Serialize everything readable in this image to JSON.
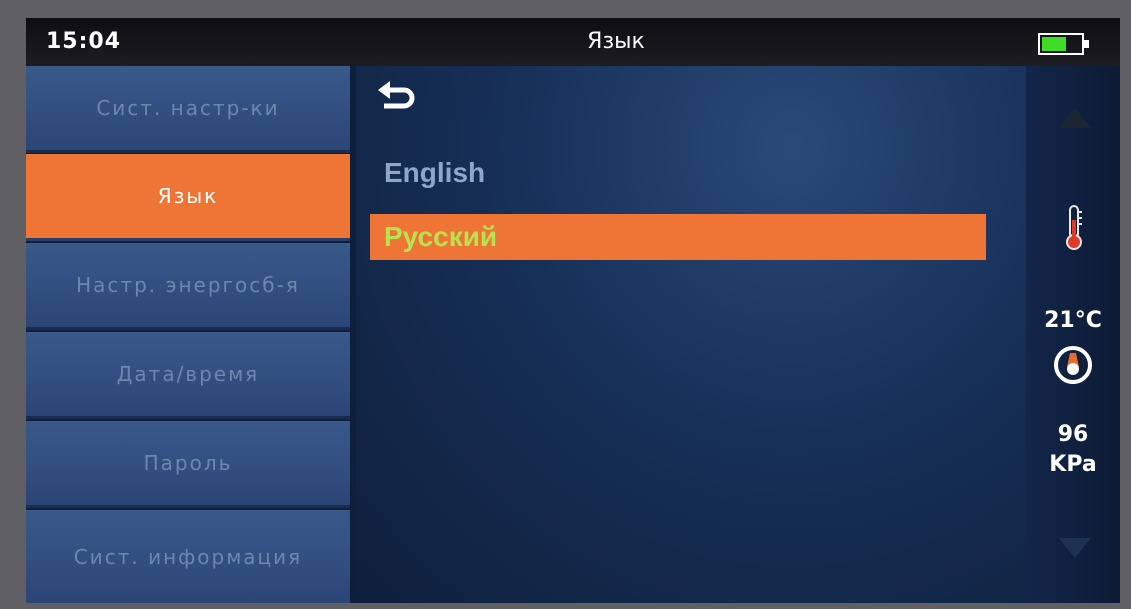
{
  "status_bar": {
    "time": "15:04",
    "title": "Язык"
  },
  "sidebar": {
    "items": [
      {
        "label": "Сист. настр-ки"
      },
      {
        "label": "Язык"
      },
      {
        "label": "Настр. энергосб-я"
      },
      {
        "label": "Дата/время"
      },
      {
        "label": "Пароль"
      },
      {
        "label": "Сист. информация"
      }
    ],
    "active_index": 1
  },
  "languages": {
    "options": [
      {
        "label": "English"
      },
      {
        "label": "Русский"
      }
    ],
    "selected_index": 1
  },
  "sensors": {
    "temperature": "21°C",
    "pressure_value": "96",
    "pressure_unit": "KPa"
  },
  "icons": {
    "back": "back-arrow-icon",
    "battery": "battery-icon",
    "scroll_up": "arrow-up-icon",
    "scroll_down": "arrow-down-icon",
    "temperature": "thermometer-icon",
    "pressure": "gauge-icon"
  },
  "colors": {
    "accent": "#ee7536",
    "selected_text": "#b7e34e",
    "battery_level": "#3fdc28"
  }
}
